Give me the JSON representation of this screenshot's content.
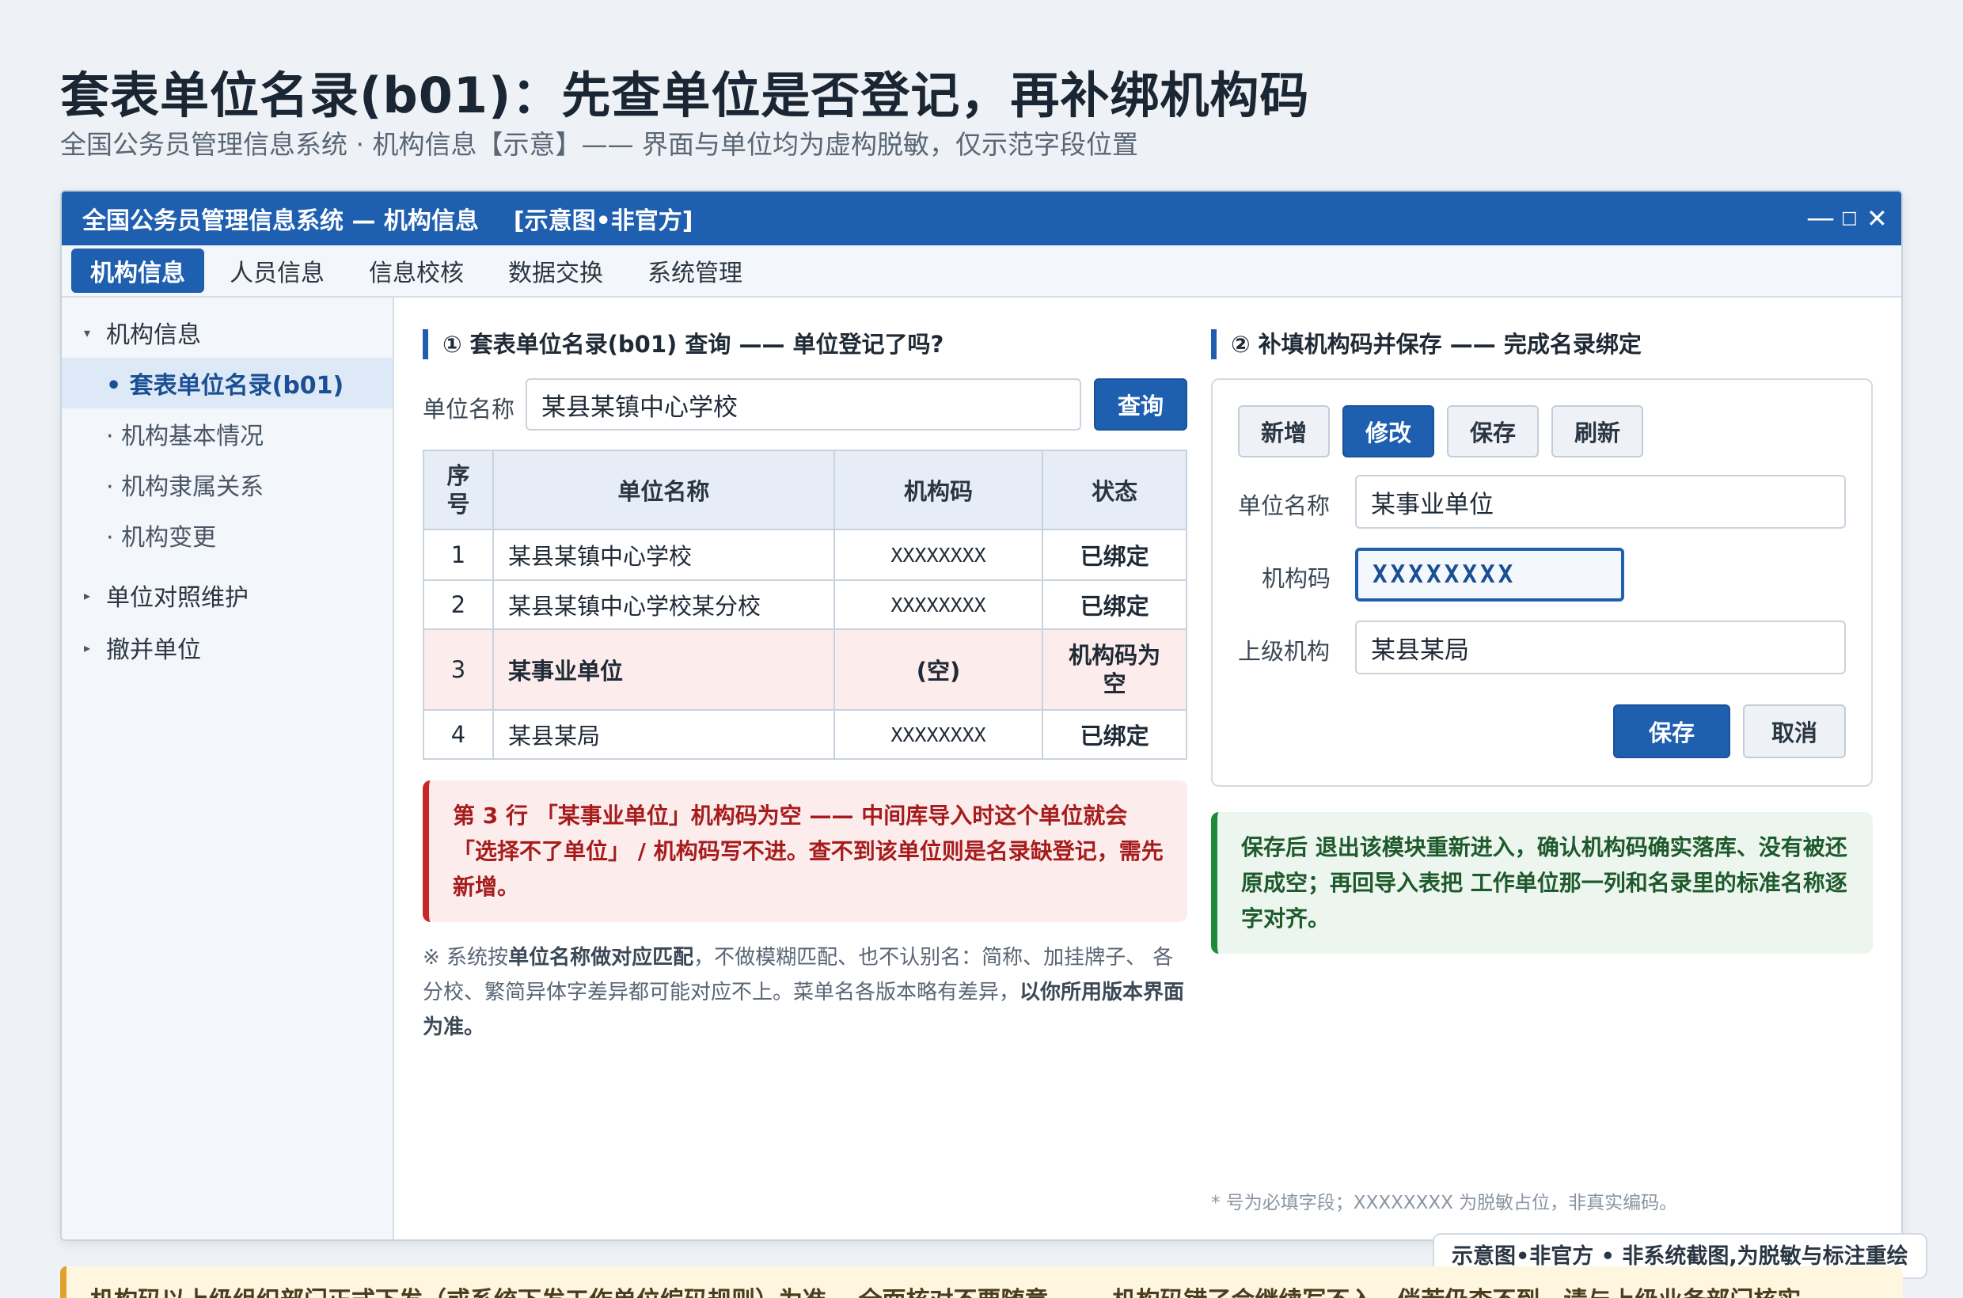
{
  "page": {
    "title": "套表单位名录(b01)：先查单位是否登记，再补绑机构码",
    "subtitle": "全国公务员管理信息系统 · 机构信息【示意】—— 界面与单位均为虚构脱敏，仅示范字段位置"
  },
  "window": {
    "title": "全国公务员管理信息系统 — 机构信息",
    "tag": "[示意图•非官方]",
    "controls": {
      "minimize": "—",
      "maximize": "□",
      "close": "✕"
    }
  },
  "menu": [
    "机构信息",
    "人员信息",
    "信息校核",
    "数据交换",
    "系统管理"
  ],
  "sidebar": {
    "groups": [
      {
        "label": "机构信息",
        "caret": "▾"
      },
      {
        "label": "单位对照维护",
        "caret": "▸"
      },
      {
        "label": "撤并单位",
        "caret": "▸"
      }
    ],
    "items": [
      "• 套表单位名录(b01)",
      "· 机构基本情况",
      "· 机构隶属关系",
      "· 机构变更"
    ]
  },
  "query": {
    "heading": "① 套表单位名录(b01) 查询 —— 单位登记了吗?",
    "label": "单位名称",
    "value": "某县某镇中心学校",
    "button": "查询",
    "columns": [
      "序号",
      "单位名称",
      "机构码",
      "状态"
    ],
    "rows": [
      {
        "no": "1",
        "name": "某县某镇中心学校",
        "code": "XXXXXXXX",
        "status": "已绑定"
      },
      {
        "no": "2",
        "name": "某县某镇中心学校某分校",
        "code": "XXXXXXXX",
        "status": "已绑定"
      },
      {
        "no": "3",
        "name": "某事业单位",
        "code": "(空)",
        "status": "机构码为空"
      },
      {
        "no": "4",
        "name": "某县某局",
        "code": "XXXXXXXX",
        "status": "已绑定"
      }
    ],
    "alert": "第 3 行 「某事业单位」机构码为空 —— 中间库导入时这个单位就会「选择不了单位」 / 机构码写不进。查不到该单位则是名录缺登记，需先新增。",
    "note_pre": "※ 系统按",
    "note_b1": "单位名称做对应匹配",
    "note_mid": "，不做模糊匹配、也不认别名：简称、加挂牌子、 各分校、繁简异体字差异都可能对应不上。菜单名各版本略有差异，",
    "note_b2": "以你所用版本界面为准。"
  },
  "edit": {
    "heading": "② 补填机构码并保存 —— 完成名录绑定",
    "toolbar": [
      "新增",
      "修改",
      "保存",
      "刷新"
    ],
    "fields": [
      {
        "label": "单位名称",
        "value": "某事业单位"
      },
      {
        "label": "机构码",
        "value": "XXXXXXXX"
      },
      {
        "label": "上级机构",
        "value": "某县某局"
      }
    ],
    "save": "保存",
    "cancel": "取消",
    "alert": "保存后 退出该模块重新进入，确认机构码确实落库、没有被还原成空；再回导入表把 工作单位那一列和名录里的标准名称逐字对齐。"
  },
  "footnote": "* 号为必填字段；XXXXXXXX 为脱敏占位，非真实编码。",
  "badge": "示意图•非官方 • 非系统截图,为脱敏与标注重绘",
  "bottom_strip": "机构码以上级组织部门正式下发（或系统下发工作单位编码规则）为准。 全面核对不要随意 —— 机构码错了会继续写不入，倘若仍查不到，请与上级业务部门核实",
  "colors": {
    "accent": "#1f5fb0",
    "danger": "#c62828",
    "success": "#1d8a3a"
  }
}
